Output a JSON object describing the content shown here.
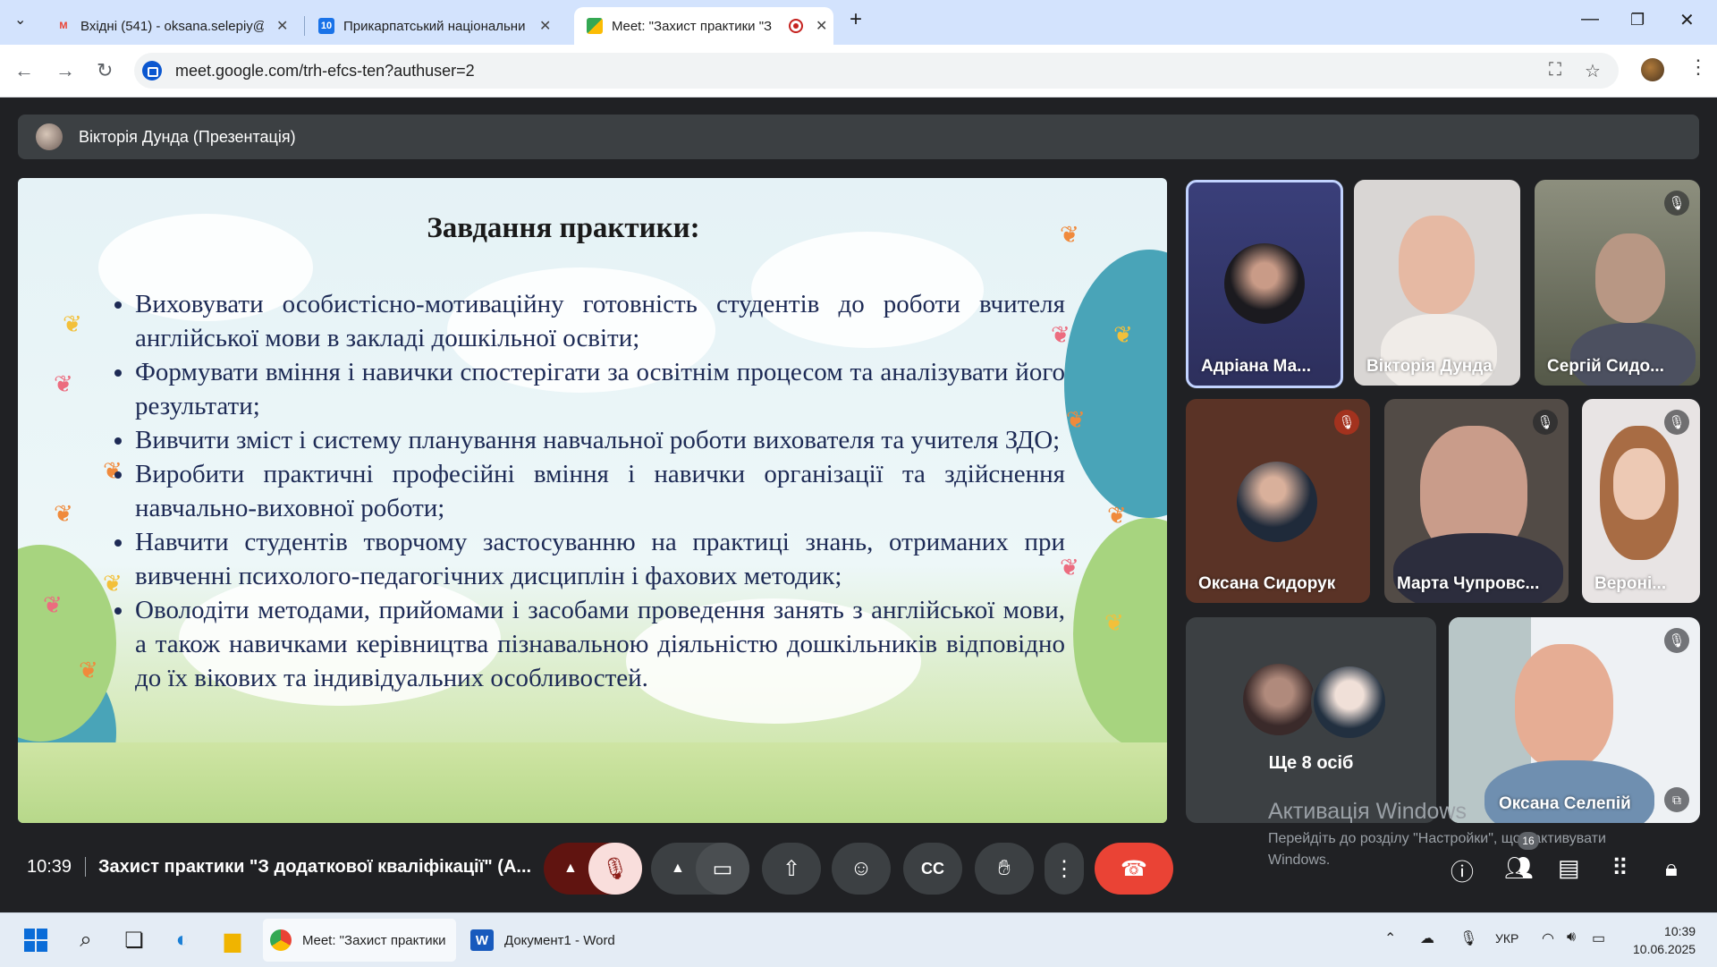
{
  "browser": {
    "tabs": [
      {
        "title": "Вхідні (541) - oksana.selepiy@p",
        "icon": "gmail-icon"
      },
      {
        "title": "Прикарпатський національни",
        "icon": "university-icon"
      },
      {
        "title": "Meet: \"Захист практики \"З",
        "icon": "meet-icon",
        "active": true
      }
    ],
    "url": "meet.google.com/trh-efcs-ten?authuser=2",
    "new_tab_glyph": "+",
    "close_glyph": "✕",
    "minimize_glyph": "—",
    "restore_glyph": "❐"
  },
  "meet": {
    "presenter_label": "Вікторія Дунда (Презентація)",
    "slide": {
      "title": "Завдання практики:",
      "bullets": [
        "Виховувати особистісно-мотиваційну готовність студентів до роботи вчителя англійської мови в закладі дошкільної освіти;",
        "Формувати вміння і навички спостерігати за освітнім процесом та аналізувати його результати;",
        "Вивчити зміст і систему планування навчальної роботи вихователя та учителя ЗДО;",
        "Виробити практичні професійні вміння і навички організації та здійснення навчально-виховної роботи;",
        "Навчити студентів творчому застосуванню на практиці знань, отриманих при вивченні психолого-педагогічних дисциплін і фахових методик;",
        "Оволодіти методами, прийомами і засобами проведення занять з англійської мови, а також навичками керівництва пізнавальною діяльністю дошкільників відповідно до їх вікових та індивідуальних особливостей."
      ]
    },
    "participants": [
      {
        "name": "Адріана Ма...",
        "muted": false
      },
      {
        "name": "Вікторія Дунда",
        "muted": false
      },
      {
        "name": "Сергій Сидо...",
        "muted": true
      },
      {
        "name": "Оксана Сидорук",
        "muted": true
      },
      {
        "name": "Марта Чупровс...",
        "muted": true
      },
      {
        "name": "Вероні...",
        "muted": true
      },
      {
        "name": "Оксана Селепій",
        "muted": true
      }
    ],
    "more_people": "Ще 8 осіб",
    "time": "10:39",
    "meeting_title": "Захист практики \"З додаткової кваліфікації\" (А...",
    "participant_count": "16",
    "watermark": {
      "line1": "Активація Windows",
      "line2": "Перейдіть до розділу \"Настройки\", щоб активувати",
      "line3": "Windows."
    }
  },
  "taskbar": {
    "apps": [
      {
        "label": "Meet: \"Захист практики",
        "active": true
      },
      {
        "label": "Документ1 - Word",
        "active": false
      }
    ],
    "lang": "УКР",
    "time": "10:39",
    "date": "10.06.2025"
  },
  "colors": {
    "tabstrip": "#d3e3fd",
    "meet_bg": "#202124",
    "end_call": "#ea4335",
    "mic_off": "#f9dedc"
  }
}
